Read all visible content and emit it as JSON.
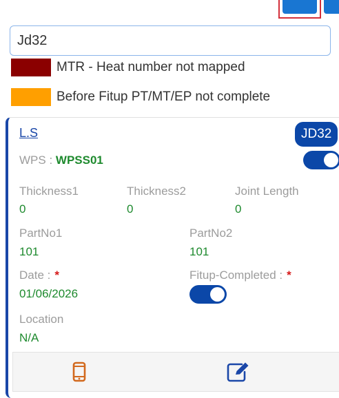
{
  "search": {
    "value": "Jd32"
  },
  "legend": [
    {
      "color": "#8b0000",
      "label": "MTR - Heat number not mapped"
    },
    {
      "color": "#ff9f00",
      "label": "Before Fitup PT/MT/EP not complete"
    }
  ],
  "card": {
    "link": "L.S",
    "badge": "JD32",
    "wps": {
      "label": "WPS :",
      "value": "WPSS01",
      "toggle_on": true
    },
    "thickness1": {
      "label": "Thickness1",
      "value": "0"
    },
    "thickness2": {
      "label": "Thickness2",
      "value": "0"
    },
    "joint_length": {
      "label": "Joint Length",
      "value": "0"
    },
    "partno1": {
      "label": "PartNo1",
      "value": "101"
    },
    "partno2": {
      "label": "PartNo2",
      "value": "101"
    },
    "date": {
      "label": "Date :",
      "required": "*",
      "value": "01/06/2026"
    },
    "fitup": {
      "label": "Fitup-Completed :",
      "required": "*",
      "toggle_on": true
    },
    "location": {
      "label": "Location",
      "value": "N/A"
    }
  },
  "colors": {
    "accent": "#0b47a8",
    "value_green": "#1e8a2e",
    "phone_icon": "#d2691e",
    "edit_icon": "#1a47a8"
  },
  "icons": {
    "footer_left": "mobile-phone-icon",
    "footer_right": "edit-icon"
  }
}
